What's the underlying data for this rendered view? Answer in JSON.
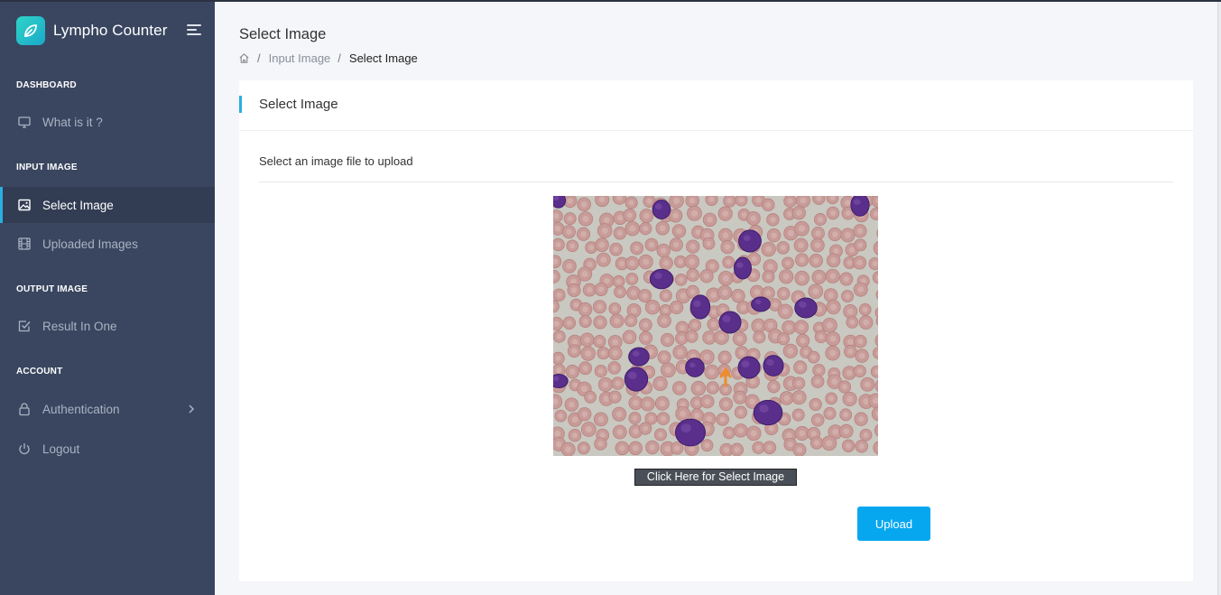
{
  "app": {
    "name": "Lympho Counter",
    "logo_icon": "leaf-icon",
    "accent": "#2ab0e0",
    "sidebar_bg": "#3a4660"
  },
  "sidebar": {
    "sections": [
      {
        "title": "DASHBOARD",
        "items": [
          {
            "label": "What is it ?",
            "icon": "monitor-icon"
          }
        ]
      },
      {
        "title": "INPUT IMAGE",
        "items": [
          {
            "label": "Select Image",
            "icon": "image-icon",
            "active": true
          },
          {
            "label": "Uploaded Images",
            "icon": "film-icon"
          }
        ]
      },
      {
        "title": "OUTPUT IMAGE",
        "items": [
          {
            "label": "Result In One",
            "icon": "check-square-icon"
          }
        ]
      },
      {
        "title": "ACCOUNT",
        "items": [
          {
            "label": "Authentication",
            "icon": "lock-icon",
            "has_submenu": true
          },
          {
            "label": "Logout",
            "icon": "power-icon"
          }
        ]
      }
    ]
  },
  "header": {
    "page_title": "Select Image",
    "breadcrumb": {
      "home_icon": "home-icon",
      "separator": "/",
      "items": [
        "Input Image",
        "Select Image"
      ]
    }
  },
  "card": {
    "title": "Select Image",
    "subtitle": "Select an image file to upload",
    "preview_alt": "Blood smear microscopy image",
    "select_button": "Click Here for Select Image",
    "upload_button": "Upload",
    "upload_color": "#07a7f0"
  }
}
